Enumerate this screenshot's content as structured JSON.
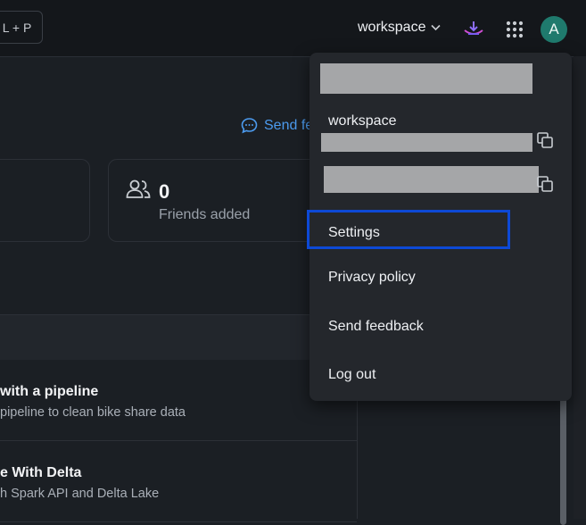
{
  "topbar": {
    "shortcut_text": "L + P",
    "workspace_label": "workspace",
    "avatar_letter": "A"
  },
  "main": {
    "send_feedback_link": "Send fe",
    "friends_count": "0",
    "friends_label": "Friends added",
    "rows": [
      {
        "title": "with a pipeline",
        "subtitle": "pipeline to clean bike share data"
      },
      {
        "title": "e With Delta",
        "subtitle": "h Spark API and Delta Lake"
      }
    ]
  },
  "dropdown": {
    "workspace_label": "workspace",
    "items": [
      {
        "label": "Settings"
      },
      {
        "label": "Privacy policy"
      },
      {
        "label": "Send feedback"
      },
      {
        "label": "Log out"
      }
    ],
    "highlighted_item": "Settings",
    "highlight_color": "#0d49d6"
  },
  "colors": {
    "background": "#1b1f24",
    "topbar": "#14171b",
    "link": "#4c9bef",
    "avatar": "#1f7a6d"
  }
}
